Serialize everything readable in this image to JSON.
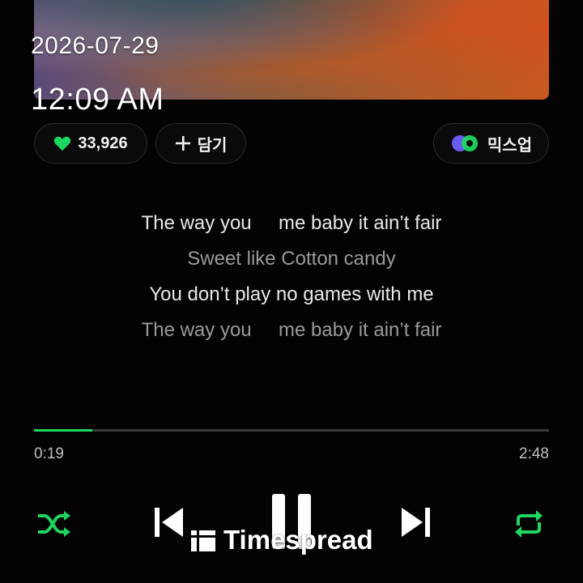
{
  "overlay": {
    "date": "2026-07-29",
    "time": "12:09 AM"
  },
  "actions": {
    "like_count": "33,926",
    "add_label": "담기",
    "mixup_label": "믹스업"
  },
  "lyrics": [
    {
      "text": "The way you     me baby it ain’t fair",
      "active": true
    },
    {
      "text": "Sweet like Cotton candy",
      "active": false
    },
    {
      "text": "You don’t play no games with me",
      "active": true
    },
    {
      "text": "The way you     me baby it ain’t fair",
      "active": false
    }
  ],
  "playback": {
    "elapsed": "0:19",
    "total": "2:48",
    "progress": 0.113
  },
  "controls": {
    "shuffle_icon": "shuffle-icon",
    "prev_icon": "skip-previous-icon",
    "play_icon": "pause-icon",
    "next_icon": "skip-next-icon",
    "repeat_icon": "repeat-icon"
  },
  "watermark": {
    "text": "Timespread"
  },
  "colors": {
    "accent": "#1ed760",
    "background": "#030303"
  }
}
